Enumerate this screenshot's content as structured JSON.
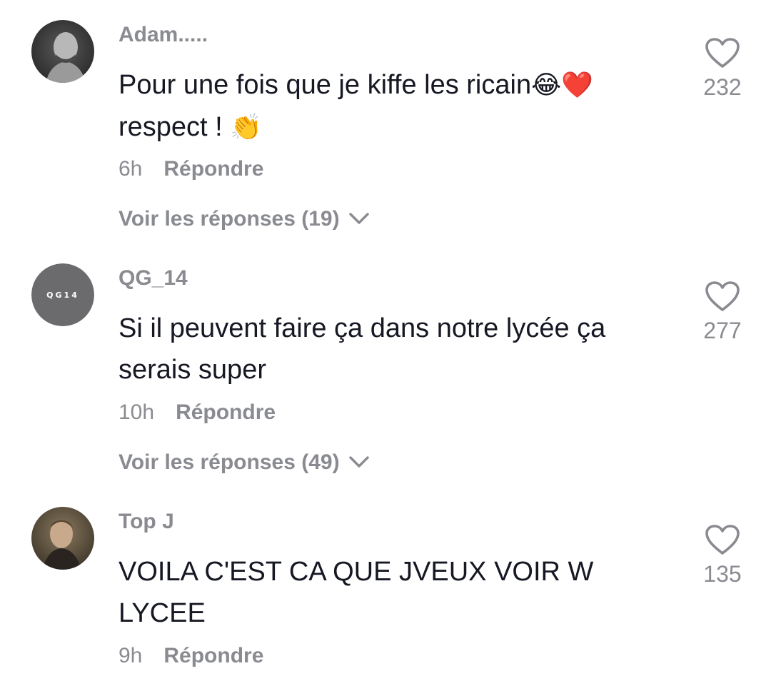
{
  "comments": [
    {
      "username": "Adam.....",
      "text_line1": "Pour une fois que je kiffe les ricain",
      "text_line2": "respect ! ",
      "emoji_laugh": "😂",
      "emoji_heart": "❤️",
      "emoji_clap": "👏",
      "time": "6h",
      "reply_label": "Répondre",
      "view_replies": "Voir les réponses (19)",
      "likes": "232"
    },
    {
      "username": "QG_14",
      "avatar_text": "QG14",
      "text": "Si il peuvent faire ça dans notre lycée ça\nserais super",
      "time": "10h",
      "reply_label": "Répondre",
      "view_replies": "Voir les réponses (49)",
      "likes": "277"
    },
    {
      "username": "Top J",
      "text": "VOILA C'EST CA QUE JVEUX VOIR W\nLYCEE",
      "time": "9h",
      "reply_label": "Répondre",
      "likes": "135"
    }
  ],
  "colors": {
    "text": "#161823",
    "secondary": "#8a8b91",
    "heart_icon": "#8a8b91"
  },
  "icons": {
    "like": "heart-outline-icon",
    "expand": "chevron-down-icon"
  }
}
